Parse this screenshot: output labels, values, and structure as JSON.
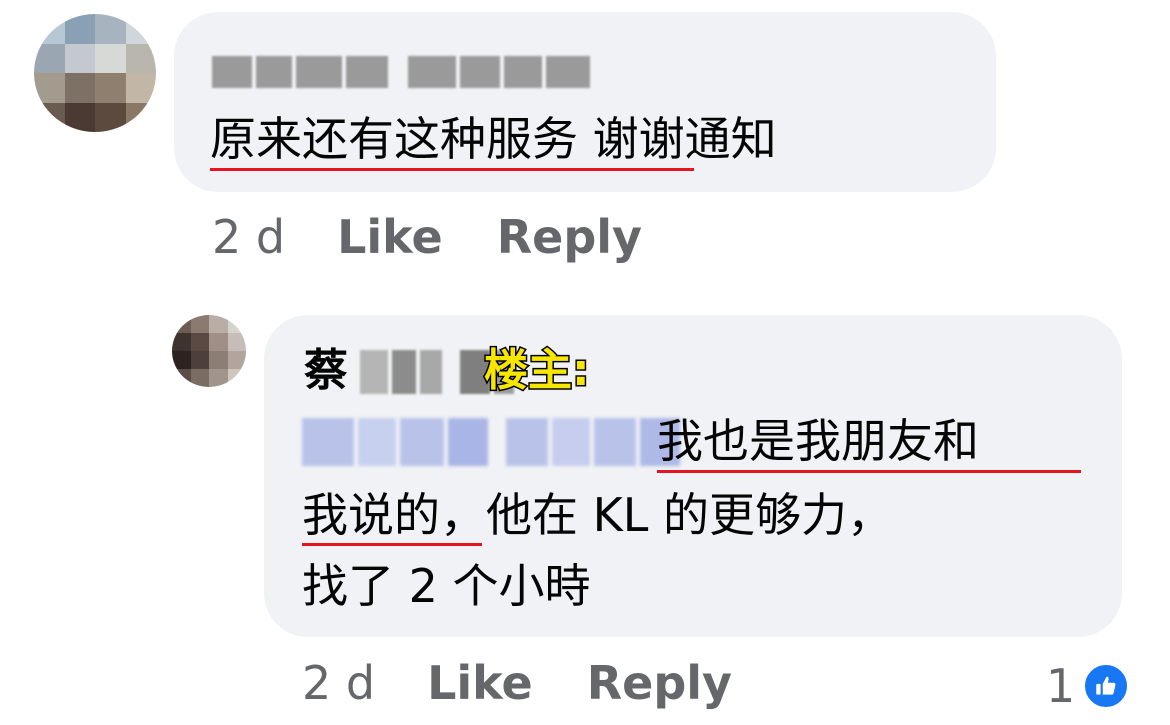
{
  "comments": [
    {
      "author_blurred": true,
      "text_underlined": "原来还有这种服务",
      "text_rest": " 谢谢通知",
      "timestamp": "2 d",
      "like_label": "Like",
      "reply_label": "Reply"
    }
  ],
  "reply": {
    "author_visible": "蔡",
    "author_blurred": true,
    "op_tag": "楼主:",
    "mention_blurred": true,
    "line1": "我也是我朋友和",
    "line2_underlined": "我说的",
    "line2_rest": "，他在 KL 的更够力，",
    "line3": "找了 2 个小時",
    "timestamp": "2 d",
    "like_label": "Like",
    "reply_label": "Reply",
    "reaction_count": "1",
    "reaction_icon": "thumbs-up-icon"
  },
  "colors": {
    "bubble_bg": "#f0f2f5",
    "meta_text": "#65676b",
    "underline": "#e4151f",
    "op_tag_fill": "#f7e600",
    "like_blue": "#1877f2"
  }
}
